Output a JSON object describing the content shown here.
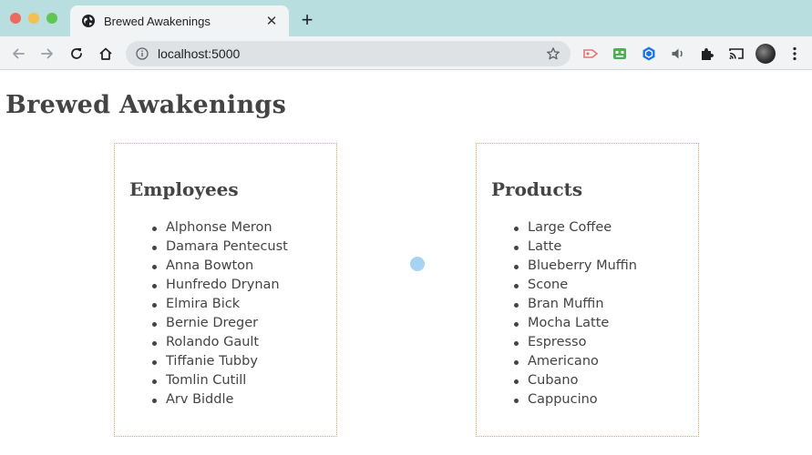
{
  "browser": {
    "tab_title": "Brewed Awakenings",
    "tab_close": "✕",
    "new_tab": "+",
    "url": "localhost:5000"
  },
  "page": {
    "title": "Brewed Awakenings"
  },
  "employees": {
    "heading": "Employees",
    "items": [
      "Alphonse Meron",
      "Damara Pentecust",
      "Anna Bowton",
      "Hunfredo Drynan",
      "Elmira Bick",
      "Bernie Dreger",
      "Rolando Gault",
      "Tiffanie Tubby",
      "Tomlin Cutill",
      "Arv Biddle"
    ]
  },
  "products": {
    "heading": "Products",
    "items": [
      "Large Coffee",
      "Latte",
      "Blueberry Muffin",
      "Scone",
      "Bran Muffin",
      "Mocha Latte",
      "Espresso",
      "Americano",
      "Cubano",
      "Cappucino"
    ]
  },
  "icons": {
    "favicon": "globe-icon",
    "back": "arrow-left-icon",
    "forward": "arrow-right-icon",
    "reload": "reload-icon",
    "home": "home-icon",
    "info": "info-icon",
    "bookmark": "star-icon",
    "extensions": [
      "cast-extension-icon",
      "robot-extension-icon",
      "hexagon-extension-icon",
      "speaker-icon",
      "puzzle-icon",
      "cast-icon"
    ],
    "menu": "kebab-menu-icon"
  },
  "colors": {
    "tabbar_bg": "#b9dedf",
    "toolbar_bg": "#f1f3f4",
    "text": "#444444",
    "card_border": "#e0a65a",
    "cursor_dot": "#a6d3f2"
  }
}
